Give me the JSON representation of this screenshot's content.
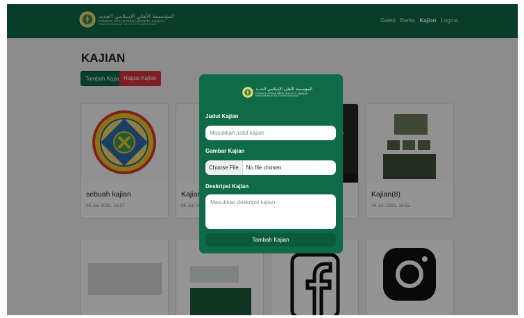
{
  "brand": {
    "arabic": "المؤسسة الأهلي الإسلامي الجديد",
    "line1": "PONDOK PESANTREN LEDOKTA JANNAH",
    "line2": "PENGEMBANGAN TALLO KOTA MAKASSAR"
  },
  "nav": {
    "items": [
      {
        "label": "Galeri",
        "active": false
      },
      {
        "label": "Berita",
        "active": false
      },
      {
        "label": "Kajian",
        "active": true
      },
      {
        "label": "Logout",
        "active": false
      }
    ]
  },
  "page": {
    "title": "KAJIAN",
    "add_button": "Tambah Kajian",
    "delete_button": "Hapus Kajian"
  },
  "cards": [
    {
      "title": "sebuah kajian",
      "date": "06 Jun 2025, 16:37"
    },
    {
      "title": "Kajian(",
      "date": "06 Jun 20"
    },
    {
      "title": "",
      "date": ""
    },
    {
      "title": "Kajian(8)",
      "date": "06 Jun 2025, 16:55"
    }
  ],
  "modal": {
    "title_label": "Judul Kajian",
    "title_placeholder": "Masukkan judul kajian",
    "image_label": "Gambar Kajian",
    "file_button": "Choose File",
    "file_status": "No file chosen",
    "desc_label": "Deskripsi Kajian",
    "desc_placeholder": "Masukkan deskripsi kajian",
    "submit": "Tambah Kajian"
  },
  "colors": {
    "primary": "#0f6a47",
    "danger": "#d9353f",
    "overlay": "rgba(0,0,0,0.42)"
  }
}
